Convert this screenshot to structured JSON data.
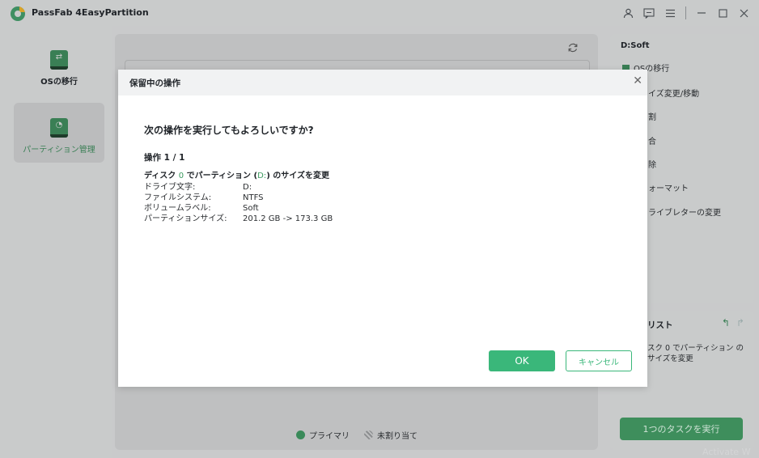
{
  "app": {
    "title": "PassFab 4EasyPartition"
  },
  "titlebar": {
    "icons": [
      "user-icon",
      "feedback-icon",
      "menu-icon",
      "minimize-icon",
      "maximize-icon",
      "close-icon"
    ]
  },
  "nav": {
    "items": [
      {
        "label": "OSの移行",
        "icon": "migrate-icon"
      },
      {
        "label": "パーティション管理",
        "icon": "partition-icon"
      }
    ]
  },
  "center": {
    "legend": {
      "primary": "プライマリ",
      "unallocated": "未割り当て"
    }
  },
  "right_panel": {
    "title": "D:Soft",
    "items": [
      "OSの移行",
      "イズ変更/移動",
      "割",
      "合",
      "除",
      "ォーマット",
      "ライブレターの変更"
    ]
  },
  "task_panel": {
    "title": "リスト",
    "text": "スク 0 でパーティション のサイズを変更",
    "run_button": "1つのタスクを実行"
  },
  "modal": {
    "title": "保留中の操作",
    "question": "次の操作を実行してもよろしいですか?",
    "operation": "操作 1 / 1",
    "desc_pre": "ディスク ",
    "desc_disk": "0",
    "desc_mid": " でパーティション (",
    "desc_drive": "D:",
    "desc_post": ") のサイズを変更",
    "details": [
      {
        "key": "ドライブ文字:",
        "value": "D:"
      },
      {
        "key": "ファイルシステム:",
        "value": "NTFS"
      },
      {
        "key": "ボリュームラベル:",
        "value": "Soft"
      },
      {
        "key": "パーティションサイズ:",
        "value": "201.2 GB -> 173.3 GB"
      }
    ],
    "ok": "OK",
    "cancel": "キャンセル"
  },
  "watermark": "Activate W",
  "colors": {
    "accent": "#3ab77a",
    "brand": "#3a7f55"
  }
}
